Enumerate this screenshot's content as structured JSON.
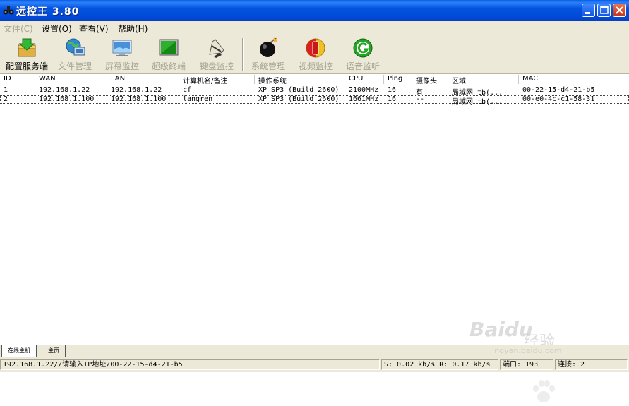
{
  "window": {
    "title": "远控王  3.80"
  },
  "menu": [
    {
      "label": "文件(C)",
      "enabled": false
    },
    {
      "label": "设置(O)",
      "enabled": true
    },
    {
      "label": "查看(V)",
      "enabled": true
    },
    {
      "label": "帮助(H)",
      "enabled": true
    }
  ],
  "toolbar": [
    {
      "label": "配置服务端",
      "icon": "config-server-icon",
      "enabled": true
    },
    {
      "label": "文件管理",
      "icon": "file-manager-icon",
      "enabled": false
    },
    {
      "label": "屏幕监控",
      "icon": "screen-monitor-icon",
      "enabled": false
    },
    {
      "label": "超级终端",
      "icon": "terminal-icon",
      "enabled": false
    },
    {
      "label": "键盘监控",
      "icon": "keyboard-monitor-icon",
      "enabled": false
    },
    {
      "label": "系统管理",
      "icon": "system-manage-icon",
      "enabled": false
    },
    {
      "label": "视频监控",
      "icon": "video-monitor-icon",
      "enabled": false
    },
    {
      "label": "语音监听",
      "icon": "voice-monitor-icon",
      "enabled": false
    }
  ],
  "table": {
    "columns": [
      "ID",
      "WAN",
      "LAN",
      "计算机名/备注",
      "操作系统",
      "CPU",
      "Ping",
      "摄像头",
      "区域",
      "MAC"
    ],
    "rows": [
      [
        "1",
        "192.168.1.22",
        "192.168.1.22",
        "cf",
        "XP SP3 (Build 2600)",
        "2100MHz",
        "16",
        "有",
        "局域网 tb(...",
        "00-22-15-d4-21-b5"
      ],
      [
        "2",
        "192.168.1.100",
        "192.168.1.100",
        "langren",
        "XP SP3 (Build 2600)",
        "1661MHz",
        "16",
        "--",
        "局域网 tb(...",
        "00-e0-4c-c1-58-31"
      ]
    ]
  },
  "tabs": [
    "在线主机",
    "主页"
  ],
  "status": {
    "address": "192.168.1.22//请输入IP地址/00-22-15-d4-21-b5",
    "speed": "S: 0.02 kb/s R: 0.17 kb/s",
    "port": "端口: 193",
    "connections": "连接: 2"
  },
  "watermark": {
    "brand": "Baidu",
    "cn": "经验",
    "url": "jingyan.baidu.com"
  }
}
